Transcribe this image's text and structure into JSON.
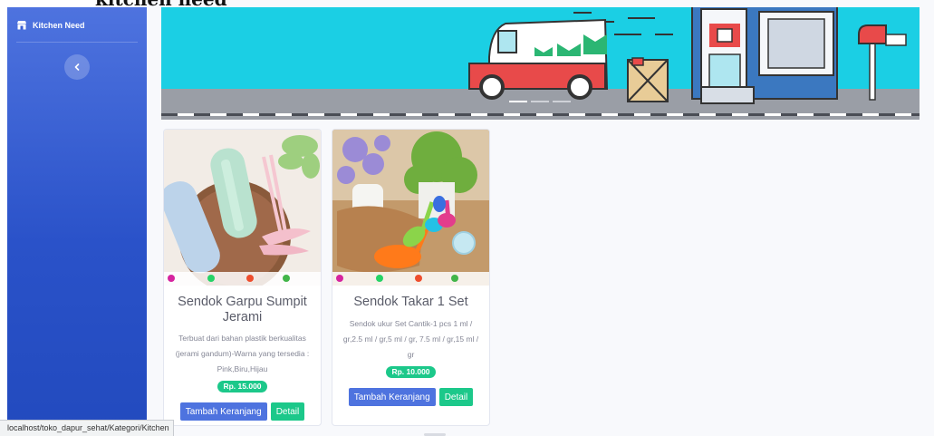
{
  "page": {
    "heading": "kitchen need"
  },
  "sidebar": {
    "brand": "Kitchen Need",
    "brand_icon": "store-icon",
    "toggle_icon": "chevron-left-icon"
  },
  "banner": {
    "carousel_indicators": 3,
    "active_indicator": 1
  },
  "products": [
    {
      "title": "Sendok Garpu Sumpit Jerami",
      "description": "Terbuat dari bahan plastik berkualitas (jerami gandum)-Warna yang tersedia : Pink,Biru,Hijau",
      "price": "Rp. 15.000",
      "add_button": "Tambah Keranjang",
      "detail_button": "Detail"
    },
    {
      "title": "Sendok Takar 1 Set",
      "description": "Sendok ukur Set Cantik-1 pcs 1 ml / gr,2.5 ml / gr,5 ml / gr, 7.5 ml / gr,15 ml / gr",
      "price": "Rp. 10.000",
      "add_button": "Tambah Keranjang",
      "detail_button": "Detail"
    }
  ],
  "status_bar": {
    "url": "localhost/toko_dapur_sehat/Kategori/Kitchen"
  },
  "colors": {
    "primary": "#4e73df",
    "success": "#1cc88a",
    "banner_sky": "#1bcfe4",
    "sidebar_dark": "#224abe"
  }
}
